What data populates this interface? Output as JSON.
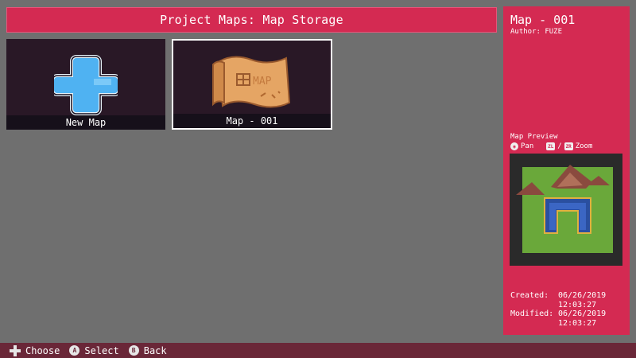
{
  "header": {
    "title": "Project Maps: Map Storage"
  },
  "tiles": [
    {
      "label": "New Map",
      "icon": "plus-icon"
    },
    {
      "label": "Map - 001",
      "icon": "map-scroll-icon",
      "art_text": "MAP",
      "selected": true
    }
  ],
  "details": {
    "map_title": "Map - 001",
    "author": "Author: FUZE",
    "preview_label": "Map Preview",
    "pan_label": "Pan",
    "zoom_separator": "/",
    "zoom_label": "Zoom",
    "zl_glyph": "ZL",
    "zr_glyph": "ZR",
    "created_label": "Created:",
    "created_date": "06/26/2019",
    "created_time": "12:03:27",
    "modified_label": "Modified:",
    "modified_date": "06/26/2019",
    "modified_time": "12:03:27"
  },
  "footer": {
    "choose_label": "Choose",
    "select_label": "Select",
    "back_label": "Back",
    "a_glyph": "A",
    "b_glyph": "B"
  },
  "colors": {
    "accent": "#d42a52",
    "background": "#6f6f6f",
    "tile": "#291826",
    "footer": "#6a2738"
  }
}
